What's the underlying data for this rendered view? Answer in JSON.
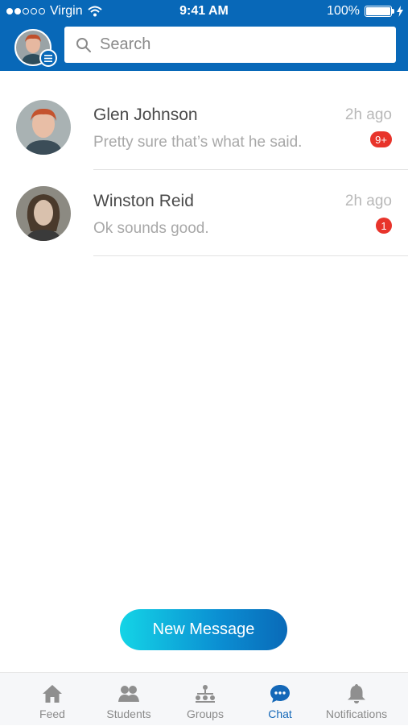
{
  "status_bar": {
    "carrier": "Virgin",
    "time": "9:41 AM",
    "battery": "100%"
  },
  "header": {
    "search_placeholder": "Search"
  },
  "conversations": [
    {
      "name": "Glen Johnson",
      "preview": "Pretty sure that’s what he said.",
      "time": "2h ago",
      "unread": "9+"
    },
    {
      "name": "Winston Reid",
      "preview": "Ok sounds good.",
      "time": "2h ago",
      "unread": "1"
    }
  ],
  "new_message_label": "New Message",
  "tabs": [
    {
      "label": "Feed",
      "icon": "home-icon"
    },
    {
      "label": "Students",
      "icon": "people-icon"
    },
    {
      "label": "Groups",
      "icon": "group-icon"
    },
    {
      "label": "Chat",
      "icon": "chat-icon",
      "active": true
    },
    {
      "label": "Notifications",
      "icon": "bell-icon"
    }
  ],
  "colors": {
    "brand_blue": "#0868b8",
    "badge_red": "#e8342b",
    "active_tab": "#1468b8"
  }
}
